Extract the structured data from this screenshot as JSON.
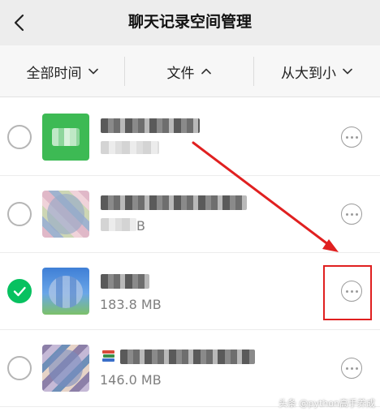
{
  "header": {
    "title": "聊天记录空间管理",
    "back_icon": "chevron-left-icon"
  },
  "filters": [
    {
      "label": "全部时间",
      "chevron": "chevron-down-icon"
    },
    {
      "label": "文件",
      "chevron": "chevron-up-icon"
    },
    {
      "label": "从大到小",
      "chevron": "chevron-down-icon"
    }
  ],
  "files": [
    {
      "size": "",
      "selected": false
    },
    {
      "size": "B",
      "selected": false
    },
    {
      "size": "183.8 MB",
      "selected": true
    },
    {
      "size": "146.0 MB",
      "selected": false
    }
  ],
  "watermark": "头条 @python高手养成",
  "colors": {
    "accent_green": "#07c160",
    "annotation_red": "#e02020",
    "header_bg": "#ededed"
  }
}
